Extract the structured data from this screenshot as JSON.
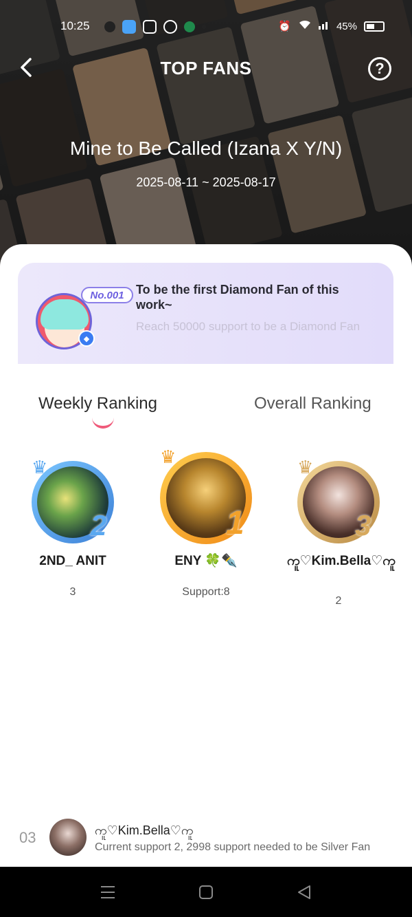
{
  "status_bar": {
    "time": "10:25",
    "battery": "45%"
  },
  "header": {
    "title": "TOP FANS",
    "help_symbol": "?",
    "work_title": "Mine to Be Called (Izana X Y/N)",
    "date_range": "2025-08-11 ~ 2025-08-17"
  },
  "diamond_card": {
    "badge": "No.001",
    "title": "To be the first Diamond Fan of this work~",
    "subtitle": "Reach 50000 support to be a Diamond Fan"
  },
  "tabs": {
    "weekly": "Weekly Ranking",
    "overall": "Overall Ranking",
    "active": "weekly"
  },
  "podium": {
    "first": {
      "rank": "1",
      "name": "ENY 🍀✒️",
      "support": "Support:8"
    },
    "second": {
      "rank": "2",
      "name": "2ND_ ANIT",
      "support": "3"
    },
    "third": {
      "rank": "3",
      "name": "ကူ♡Kim.Bella♡ကူ",
      "support": "2"
    }
  },
  "current_user": {
    "rank": "03",
    "name": "ကူ♡Kim.Bella♡ကူ",
    "status": "Current support 2, 2998 support needed to be Silver Fan"
  },
  "colors": {
    "accent": "#ef5a7a",
    "card_purple": "#e6e1fb",
    "gold": "#f2a12b",
    "silver_blue": "#5aa8f0",
    "bronze": "#d7a95d"
  }
}
